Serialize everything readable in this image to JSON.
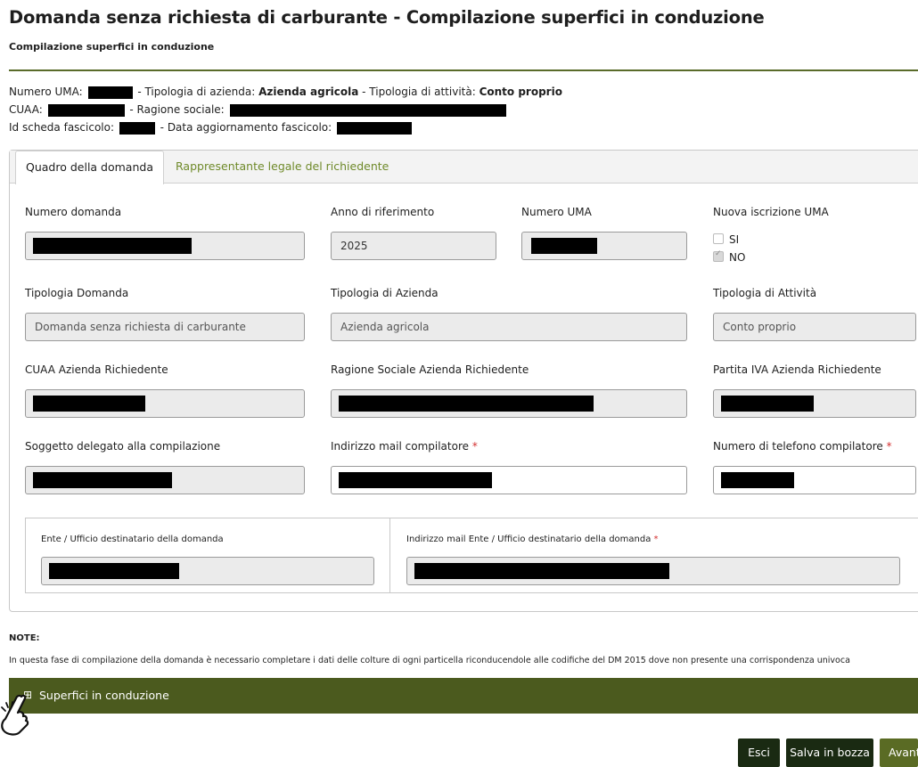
{
  "page": {
    "title": "Domanda senza richiesta di carburante - Compilazione superfici in conduzione",
    "subtitle": "Compilazione superfici in conduzione"
  },
  "info": {
    "numero_uma_label": "Numero UMA:",
    "tipologia_azienda_label": "- Tipologia di azienda:",
    "tipologia_azienda_value": "Azienda agricola",
    "tipologia_attivita_label": "- Tipologia di attività:",
    "tipologia_attivita_value": "Conto proprio",
    "cuaa_label": "CUAA:",
    "ragione_sociale_label": "- Ragione sociale:",
    "id_scheda_label": "Id scheda fascicolo:",
    "data_aggiornamento_label": "- Data aggiornamento fascicolo:"
  },
  "tabs": [
    {
      "label": "Quadro della domanda",
      "active": true
    },
    {
      "label": "Rappresentante legale del richiedente",
      "active": false
    }
  ],
  "form": {
    "numero_domanda_label": "Numero domanda",
    "anno_label": "Anno di riferimento",
    "anno_value": "2025",
    "numero_uma_label": "Numero UMA",
    "nuova_iscrizione_label": "Nuova iscrizione UMA",
    "opt_si": "SI",
    "opt_no": "NO",
    "tipologia_domanda_label": "Tipologia Domanda",
    "tipologia_domanda_value": "Domanda senza richiesta di carburante",
    "tipologia_azienda_label": "Tipologia di Azienda",
    "tipologia_azienda_value": "Azienda agricola",
    "tipologia_attivita_label": "Tipologia di Attività",
    "tipologia_attivita_value": "Conto proprio",
    "cuaa_label": "CUAA Azienda Richiedente",
    "ragione_sociale_label": "Ragione Sociale Azienda Richiedente",
    "partita_iva_label": "Partita IVA Azienda Richiedente",
    "soggetto_delegato_label": "Soggetto delegato alla compilazione",
    "mail_compilatore_label": "Indirizzo mail compilatore",
    "telefono_label": "Numero di telefono compilatore",
    "required_mark": "*",
    "ente_label": "Ente / Ufficio destinatario della domanda",
    "mail_ente_label": "Indirizzo mail Ente / Ufficio destinatario della domanda"
  },
  "note": {
    "title": "NOTE:",
    "text": "In questa fase di compilazione della domanda è necessario completare i dati delle colture di ogni particella riconducendole alle codifiche del DM 2015 dove non presente una corrispondenza univoca"
  },
  "accordion": {
    "icon": "⊞",
    "label": "Superfici in conduzione"
  },
  "buttons": {
    "esci": "Esci",
    "salva": "Salva in bozza",
    "avanti": "Avanti"
  },
  "colors": {
    "accent": "#4b5a1e",
    "tab_link": "#6f8a2a",
    "required": "#d32f2f"
  }
}
